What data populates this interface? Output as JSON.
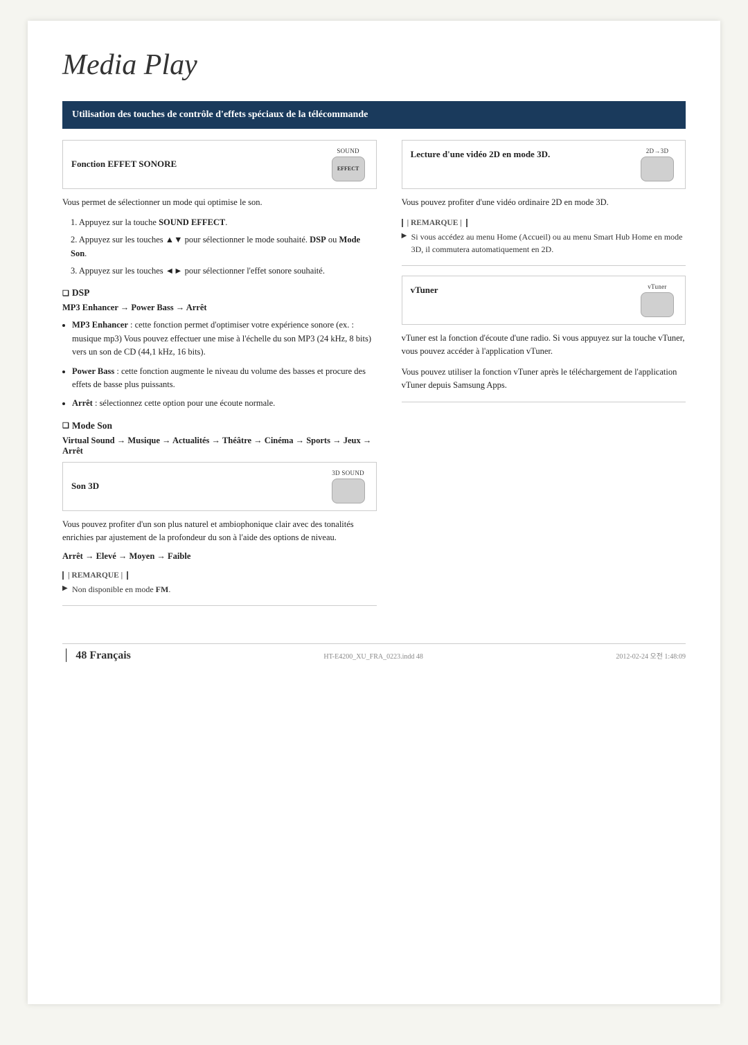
{
  "page": {
    "title": "Media Play",
    "footer": {
      "page_number": "48",
      "language": "Français",
      "pipe": "│",
      "file": "HT-E4200_XU_FRA_0223.indd  48",
      "date": "2012-02-24  오전 1:48:09"
    }
  },
  "header": {
    "text": "Utilisation des touches de contrôle d'effets spéciaux de la télécommande"
  },
  "left_col": {
    "feature_row": {
      "label": "Fonction EFFET SONORE",
      "btn_label": "SOUND",
      "btn_body": "EFFECT"
    },
    "intro_text": "Vous permet de sélectionner un mode qui optimise le son.",
    "steps": [
      {
        "num": "1",
        "text": "Appuyez sur la touche SOUND EFFECT."
      },
      {
        "num": "2",
        "text": "Appuyez sur les touches ▲▼ pour sélectionner le mode souhaité. DSP ou Mode Son."
      },
      {
        "num": "3",
        "text": "Appuyez sur les touches ◄► pour sélectionner l'effet sonore souhaité."
      }
    ],
    "dsp_section": {
      "title": "DSP",
      "chain": "MP3 Enhancer → Power Bass → Arrêt",
      "bullets": [
        {
          "term": "MP3 Enhancer",
          "text": ": cette fonction permet d'optimiser votre expérience sonore (ex. : musique mp3) Vous pouvez effectuer une mise à l'échelle du son MP3 (24 kHz, 8 bits) vers un son de CD (44,1 kHz, 16 bits)."
        },
        {
          "term": "Power Bass",
          "text": ": cette fonction augmente le niveau du volume des basses et procure des effets de basse plus puissants."
        },
        {
          "term": "Arrêt",
          "text": ": sélectionnez cette option pour une écoute normale."
        }
      ]
    },
    "modeson_section": {
      "title": "Mode Son",
      "chain": "Virtual Sound → Musique → Actualités → Théâtre → Cinéma → Sports → Jeux → Arrêt"
    },
    "son3d_row": {
      "label": "Son 3D",
      "btn_label": "3D SOUND",
      "btn_body": ""
    },
    "son3d_text": "Vous pouvez profiter d'un son plus naturel et ambiophonique clair avec des tonalités enrichies par ajustement de la profondeur du son à l'aide des options de niveau.",
    "son3d_chain": "Arrêt → Elevé → Moyen → Faible",
    "note": {
      "header": "| REMARQUE |",
      "item": "Non disponible en mode FM."
    }
  },
  "right_col": {
    "lecture_row": {
      "label": "Lecture d'une vidéo 2D en mode 3D.",
      "btn_label": "2D→3D",
      "btn_body": ""
    },
    "lecture_text": "Vous pouvez profiter d'une vidéo ordinaire 2D en mode 3D.",
    "lecture_note": {
      "header": "| REMARQUE |",
      "item": "Si vous accédez au menu Home (Accueil) ou au menu Smart Hub Home en mode 3D, il commutera automatiquement en 2D."
    },
    "vtuner_row": {
      "label": "vTuner",
      "btn_label": "vTuner",
      "btn_body": ""
    },
    "vtuner_text1": "vTuner est la fonction d'écoute d'une radio. Si vous appuyez sur la touche vTuner, vous pouvez accéder à l'application vTuner.",
    "vtuner_text2": "Vous pouvez utiliser la fonction vTuner après le téléchargement de l'application vTuner depuis Samsung Apps."
  }
}
